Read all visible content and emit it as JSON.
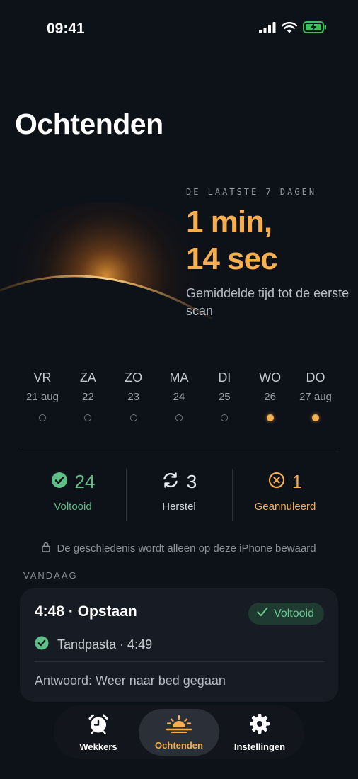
{
  "status_bar": {
    "time": "09:41"
  },
  "header": {
    "title": "Ochtenden"
  },
  "hero": {
    "period_label": "DE LAATSTE 7 DAGEN",
    "avg_line1": "1 min,",
    "avg_line2": "14 sec",
    "avg_sub": "Gemiddelde tijd tot de eerste scan"
  },
  "week": [
    {
      "name": "VR",
      "date": "21 aug",
      "active": false
    },
    {
      "name": "ZA",
      "date": "22",
      "active": false
    },
    {
      "name": "ZO",
      "date": "23",
      "active": false
    },
    {
      "name": "MA",
      "date": "24",
      "active": false
    },
    {
      "name": "DI",
      "date": "25",
      "active": false
    },
    {
      "name": "WO",
      "date": "26",
      "active": true
    },
    {
      "name": "DO",
      "date": "27 aug",
      "active": true
    }
  ],
  "stats": {
    "done": {
      "value": "24",
      "label": "Voltooid",
      "icon": "check-circle-icon"
    },
    "restore": {
      "value": "3",
      "label": "Herstel",
      "icon": "sync-icon"
    },
    "cancel": {
      "value": "1",
      "label": "Geannuleerd",
      "icon": "x-circle-icon"
    }
  },
  "privacy_note": "De geschiedenis wordt alleen op deze iPhone bewaard",
  "today": {
    "section_label": "VANDAAG",
    "card": {
      "title": "4:48 · Opstaan",
      "badge": "Voltooid",
      "task": "Tandpasta · 4:49",
      "answer": "Antwoord: Weer naar bed gegaan"
    }
  },
  "tabs": [
    {
      "label": "Wekkers",
      "icon": "alarm-clock-icon",
      "active": false
    },
    {
      "label": "Ochtenden",
      "icon": "sunrise-icon",
      "active": true
    },
    {
      "label": "Instellingen",
      "icon": "gear-icon",
      "active": false
    }
  ],
  "colors": {
    "background": "#0d1118",
    "accent": "#f6ae4e",
    "success": "#5fbf87",
    "card": "#171c24"
  }
}
